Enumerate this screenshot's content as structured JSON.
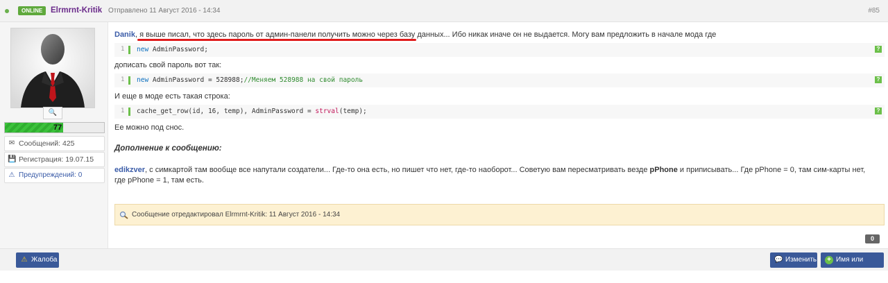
{
  "header": {
    "badge": "ONLINE",
    "author": "Elrmrnt-Kritik",
    "date": "Отправлено 11 Август 2016 - 14:34",
    "post_number": "#85"
  },
  "profile": {
    "reputation": "77",
    "reputation_fraction": 0.59,
    "messages": "Сообщений: 425",
    "registration": "Регистрация: 19.07.15",
    "warnings": "Предупреждений: 0"
  },
  "post": {
    "line1_user": "Danik",
    "line1_text": ", я выше писал, что здесь пароль от админ-панели получить можно через базу данных... Ибо никак иначе он не выдается. Могу вам предложить в начале мода где",
    "code1": {
      "line_no": "1",
      "keyword": "new",
      "text": " AdminPassword;"
    },
    "line2": "дописать свой пароль вот так:",
    "code2": {
      "line_no": "1",
      "keyword": "new",
      "text": " AdminPassword = 528988;",
      "comment": "//Меняем 528988 на свой пароль"
    },
    "line3": "И еще в моде есть такая строка:",
    "code3": {
      "line_no": "1",
      "text": "cache_get_row(id, 16, temp), AdminPassword = ",
      "func": "strval",
      "text_end": "(temp);"
    },
    "line4": "Ее можно под снос.",
    "addendum_title": "Дополнение к сообщению:",
    "para2_user": "edikzver",
    "para2_text_a": ", с симкартой там вообще все напутали создатели... Где-то она есть, но пишет что нет, где-то наоборот... Советую вам пересматривать везде ",
    "para2_bold": "pPhone",
    "para2_text_b": " и приписывать... Где pPhone = 0, там сим-карты нет, где pPhone = 1, там есть.",
    "edited_note": "Сообщение отредактировал Elrmrnt-Kritik: 11 Август 2016 - 14:34",
    "likes": "0"
  },
  "footer": {
    "report_label": "Жалоба",
    "edit_label": "Изменить",
    "quote_label": "Имя или цитата"
  },
  "colors": {
    "accent": "#3a5999",
    "online": "#5fa93c",
    "author": "#6a2a8a",
    "highlight_underline": "#e01c1c"
  }
}
